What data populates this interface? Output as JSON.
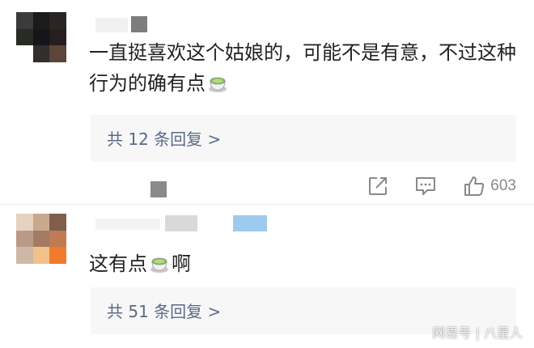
{
  "comments": [
    {
      "text_part1": "一直挺喜欢这个姑娘的，可能不是有意，不过这种行为的确有点",
      "emoji": "teacup-emoji",
      "reply_link": "共 12 条回复 >",
      "likes": "603"
    },
    {
      "text_part1": "这有点",
      "emoji": "teacup-emoji",
      "text_part2": "啊",
      "reply_link": "共 51 条回复 >"
    }
  ],
  "icons": {
    "share": "share-icon",
    "comment": "comment-icon",
    "like": "thumbs-up-icon"
  },
  "watermark": "网易号 | 八星人",
  "colors": {
    "link": "#5a6a88",
    "reply_bg": "#f7f7f8",
    "icon_gray": "#888888"
  }
}
